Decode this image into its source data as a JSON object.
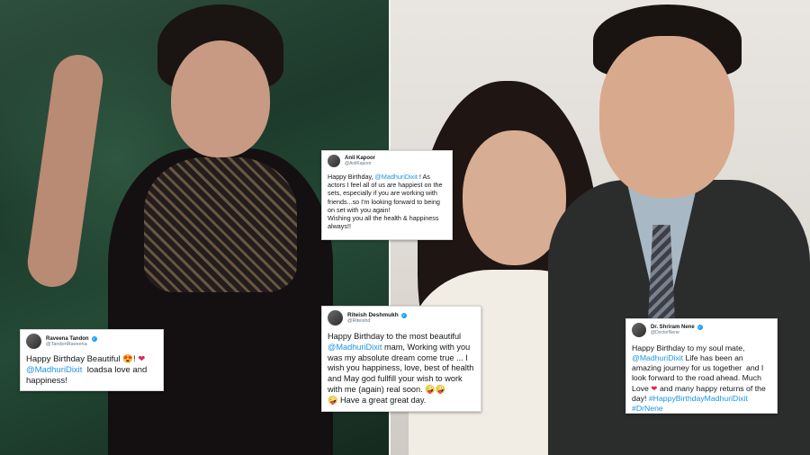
{
  "tweets": {
    "anil": {
      "name": "Anil Kapoor",
      "handle": "@AnilKapoor",
      "pre": "Happy Birthday, ",
      "mention": "@MadhuriDixit",
      "post": " ! As actors I feel all of us are happiest on the sets, especially if you are working with friends...so I'm looking forward to being on set with you again!\nWishing you all the health & happiness always!!"
    },
    "raveena": {
      "name": "Raveena Tandon",
      "handle": "@TandonRaveena",
      "line1": "Happy Birthday Beautiful 😍! ",
      "heart": "❤",
      "mention": "@MadhuriDixit",
      "post": "  loadsa love and happiness!"
    },
    "riteish": {
      "name": "Riteish Deshmukh",
      "handle": "@Riteishd",
      "pre": "Happy Birthday to the most beautiful ",
      "mention": "@MadhuriDixit",
      "post": " mam, Working with you was my absolute dream come true ... I wish you happiness, love, best of health and May god fullfill your wish to work with me (again) real soon. 🤪🤪\n🤪 Have a great great day."
    },
    "nene": {
      "name": "Dr. Shriram Nene",
      "handle": "@DoctorNene",
      "pre": "Happy Birthday to my soul mate, ",
      "mention": "@MadhuriDixit",
      "mid": " Life has been an amazing journey for us together  and I look forward to the road ahead. Much Love ",
      "heart": "❤",
      "post": " and many happy returns of the day! ",
      "hashtags": "#HappyBirthdayMadhuriDixit #DrNene"
    }
  },
  "icons": {
    "verified": "verified-badge-icon"
  },
  "colors": {
    "link": "#1b95e0",
    "verified": "#1da1f2",
    "heart": "#e0245e"
  }
}
